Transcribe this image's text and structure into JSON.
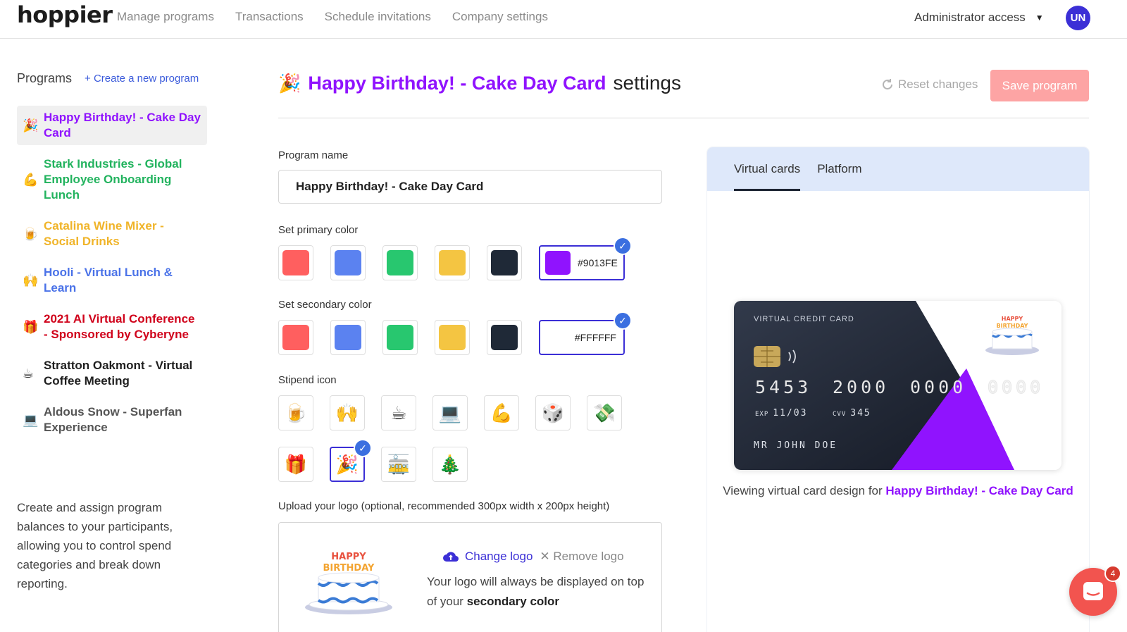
{
  "app": {
    "logo": "hoppier"
  },
  "nav": {
    "links": [
      "Manage programs",
      "Transactions",
      "Schedule invitations",
      "Company settings"
    ],
    "admin_label": "Administrator access",
    "avatar_initials": "UN"
  },
  "sidebar": {
    "title": "Programs",
    "create_label": "+ Create a new program",
    "programs": [
      {
        "emoji": "🎉",
        "name": "Happy Birthday! - Cake Day Card",
        "color": "#9013FE"
      },
      {
        "emoji": "💪",
        "name": "Stark Industries - Global Employee Onboarding Lunch",
        "color": "#22b35e"
      },
      {
        "emoji": "🍺",
        "name": "Catalina Wine Mixer - Social Drinks",
        "color": "#f0b429"
      },
      {
        "emoji": "🙌",
        "name": "Hooli - Virtual Lunch & Learn",
        "color": "#4a72e8"
      },
      {
        "emoji": "🎁",
        "name": "2021 AI Virtual Conference - Sponsored by Cyberyne",
        "color": "#d0021b"
      },
      {
        "emoji": "☕",
        "name": "Stratton Oakmont - Virtual Coffee Meeting",
        "color": "#1f1f1f"
      },
      {
        "emoji": "💻",
        "name": "Aldous Snow - Superfan Experience",
        "color": "#555555"
      }
    ],
    "description": "Create and assign program balances to your participants, allowing you to control spend categories and break down reporting."
  },
  "header": {
    "emoji": "🎉",
    "program_name": "Happy Birthday! - Cake Day Card",
    "suffix": "settings",
    "reset_label": "Reset changes",
    "save_label": "Save program"
  },
  "form": {
    "program_name_label": "Program name",
    "program_name_value": "Happy Birthday! - Cake Day Card",
    "primary_label": "Set primary color",
    "secondary_label": "Set secondary color",
    "palette": [
      "#ff5f5f",
      "#5b82f0",
      "#28c76f",
      "#f4c542",
      "#1f2937"
    ],
    "primary_custom_hex": "#9013FE",
    "secondary_custom_hex": "#FFFFFF",
    "stipend_label": "Stipend icon",
    "icons_row1": [
      "🍺",
      "🙌",
      "☕",
      "💻",
      "💪",
      "🎲",
      "💸"
    ],
    "icons_row2": [
      "🎁",
      "🎉",
      "🚋",
      "🎄"
    ],
    "selected_icon": "🎉",
    "logo_label": "Upload your logo (optional, recommended 300px width x 200px height)",
    "change_logo": "Change logo",
    "remove_logo": "Remove logo",
    "logo_note_prefix": "Your logo will always be displayed on top of your ",
    "logo_note_bold": "secondary color"
  },
  "preview": {
    "tabs": [
      "Virtual cards",
      "Platform"
    ],
    "card": {
      "title": "VIRTUAL CREDIT CARD",
      "num1": "5453",
      "num2": "2000",
      "num3": "0000",
      "num4": "0000",
      "exp_label": "EXP",
      "exp": "11/03",
      "cvv_label": "CVV",
      "cvv": "345",
      "holder": "MR JOHN DOE"
    },
    "viewing_prefix": "Viewing virtual card design for ",
    "viewing_program": "Happy Birthday! - Cake Day Card"
  },
  "chat": {
    "badge": "4"
  }
}
